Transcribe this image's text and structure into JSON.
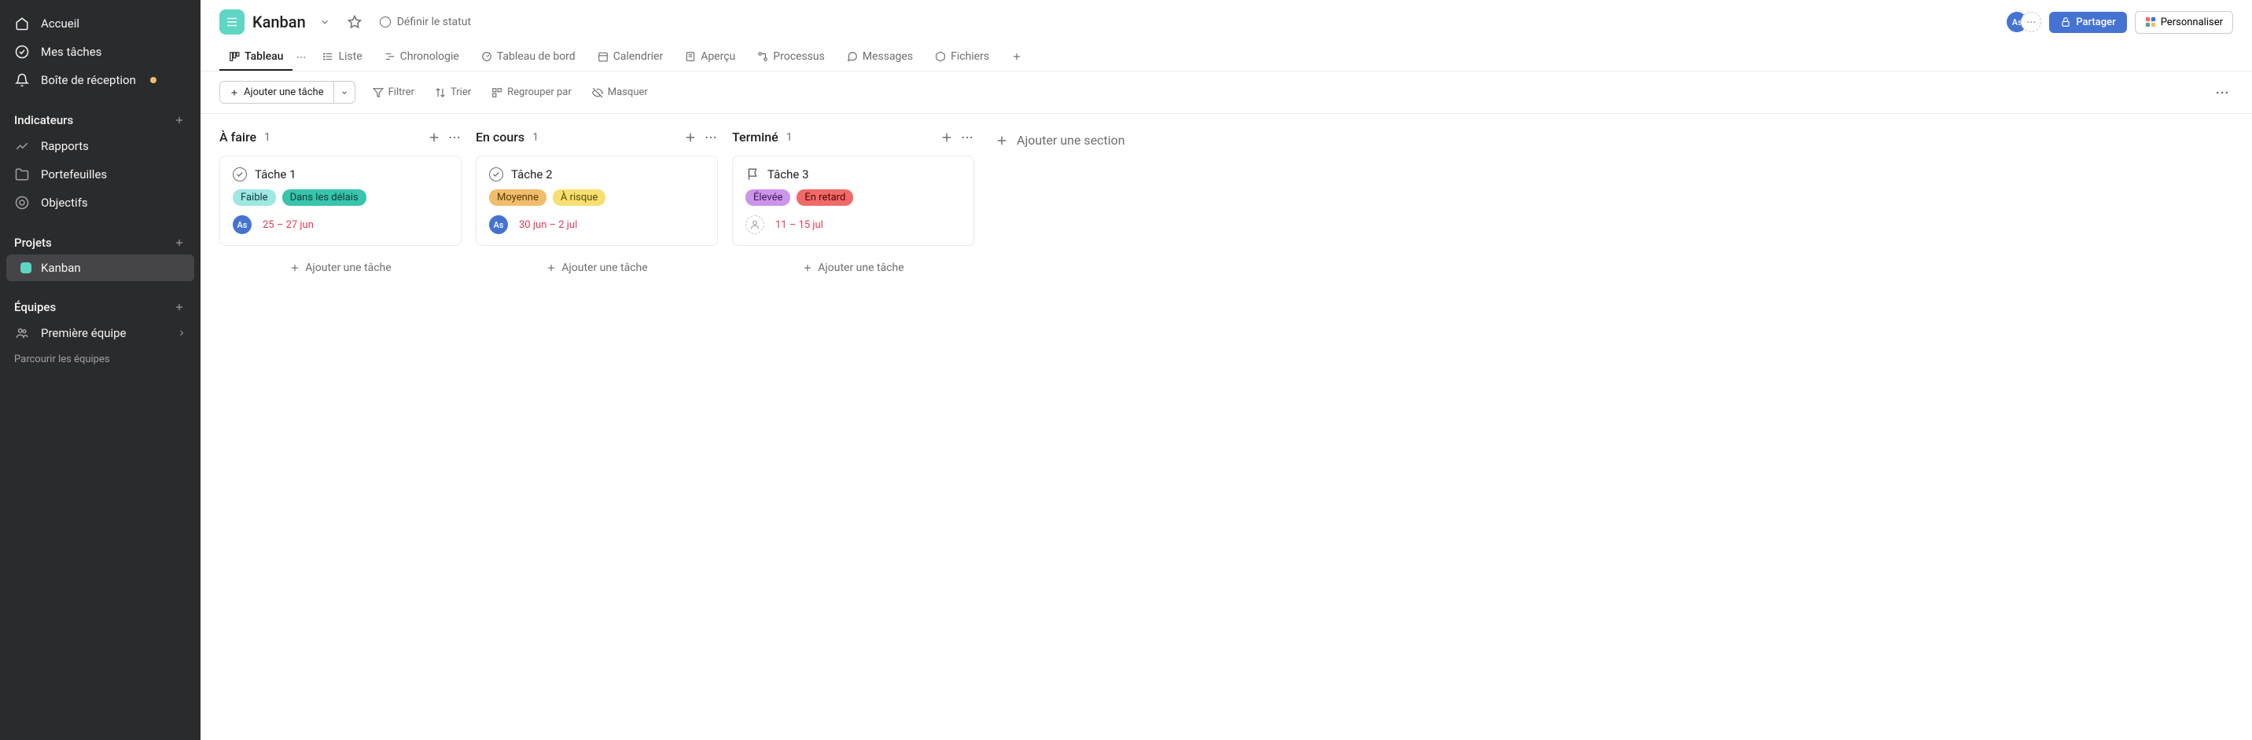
{
  "sidebar": {
    "nav": [
      {
        "label": "Accueil",
        "icon": "home-icon"
      },
      {
        "label": "Mes tâches",
        "icon": "check-circle-icon"
      },
      {
        "label": "Boîte de réception",
        "icon": "bell-icon",
        "badge": true
      }
    ],
    "sections": {
      "insights": {
        "title": "Indicateurs",
        "items": [
          {
            "label": "Rapports",
            "icon": "chart-icon"
          },
          {
            "label": "Portefeuilles",
            "icon": "folder-icon"
          },
          {
            "label": "Objectifs",
            "icon": "target-icon"
          }
        ]
      },
      "projects": {
        "title": "Projets",
        "items": [
          {
            "label": "Kanban",
            "active": true
          }
        ]
      },
      "teams": {
        "title": "Équipes",
        "items": [
          {
            "label": "Première équipe"
          }
        ],
        "browse": "Parcourir les équipes"
      }
    }
  },
  "header": {
    "title": "Kanban",
    "status": "Définir le statut",
    "avatar": "As",
    "share": "Partager",
    "customize": "Personnaliser"
  },
  "tabs": [
    {
      "label": "Tableau",
      "icon": "board-icon",
      "active": true
    },
    {
      "label": "Liste",
      "icon": "list-icon"
    },
    {
      "label": "Chronologie",
      "icon": "timeline-icon"
    },
    {
      "label": "Tableau de bord",
      "icon": "dashboard-icon"
    },
    {
      "label": "Calendrier",
      "icon": "calendar-icon"
    },
    {
      "label": "Aperçu",
      "icon": "overview-icon"
    },
    {
      "label": "Processus",
      "icon": "workflow-icon"
    },
    {
      "label": "Messages",
      "icon": "messages-icon"
    },
    {
      "label": "Fichiers",
      "icon": "files-icon"
    }
  ],
  "toolbar": {
    "add_task": "Ajouter une tâche",
    "filter": "Filtrer",
    "sort": "Trier",
    "group": "Regrouper par",
    "hide": "Masquer"
  },
  "board": {
    "add_section": "Ajouter une section",
    "add_task_label": "Ajouter une tâche",
    "columns": [
      {
        "title": "À faire",
        "count": "1",
        "cards": [
          {
            "title": "Tâche 1",
            "type": "task",
            "tags": [
              {
                "text": "Faible",
                "bg": "#9ee7e3",
                "fg": "#0d3b3b"
              },
              {
                "text": "Dans les délais",
                "bg": "#37c5ab",
                "fg": "#0d3b3b"
              }
            ],
            "avatar": "As",
            "date": "25 – 27 jun"
          }
        ]
      },
      {
        "title": "En cours",
        "count": "1",
        "cards": [
          {
            "title": "Tâche 2",
            "type": "task",
            "tags": [
              {
                "text": "Moyenne",
                "bg": "#f1bd6c",
                "fg": "#5a3b00"
              },
              {
                "text": "À risque",
                "bg": "#f8df72",
                "fg": "#5a4a00"
              }
            ],
            "avatar": "As",
            "date": "30 jun – 2 jul"
          }
        ]
      },
      {
        "title": "Terminé",
        "count": "1",
        "cards": [
          {
            "title": "Tâche 3",
            "type": "milestone",
            "tags": [
              {
                "text": "Élevée",
                "bg": "#cd95ea",
                "fg": "#3d1a5b"
              },
              {
                "text": "En retard",
                "bg": "#f06a6a",
                "fg": "#5a0000"
              }
            ],
            "avatar": "",
            "date": "11 – 15 jul"
          }
        ]
      }
    ]
  }
}
